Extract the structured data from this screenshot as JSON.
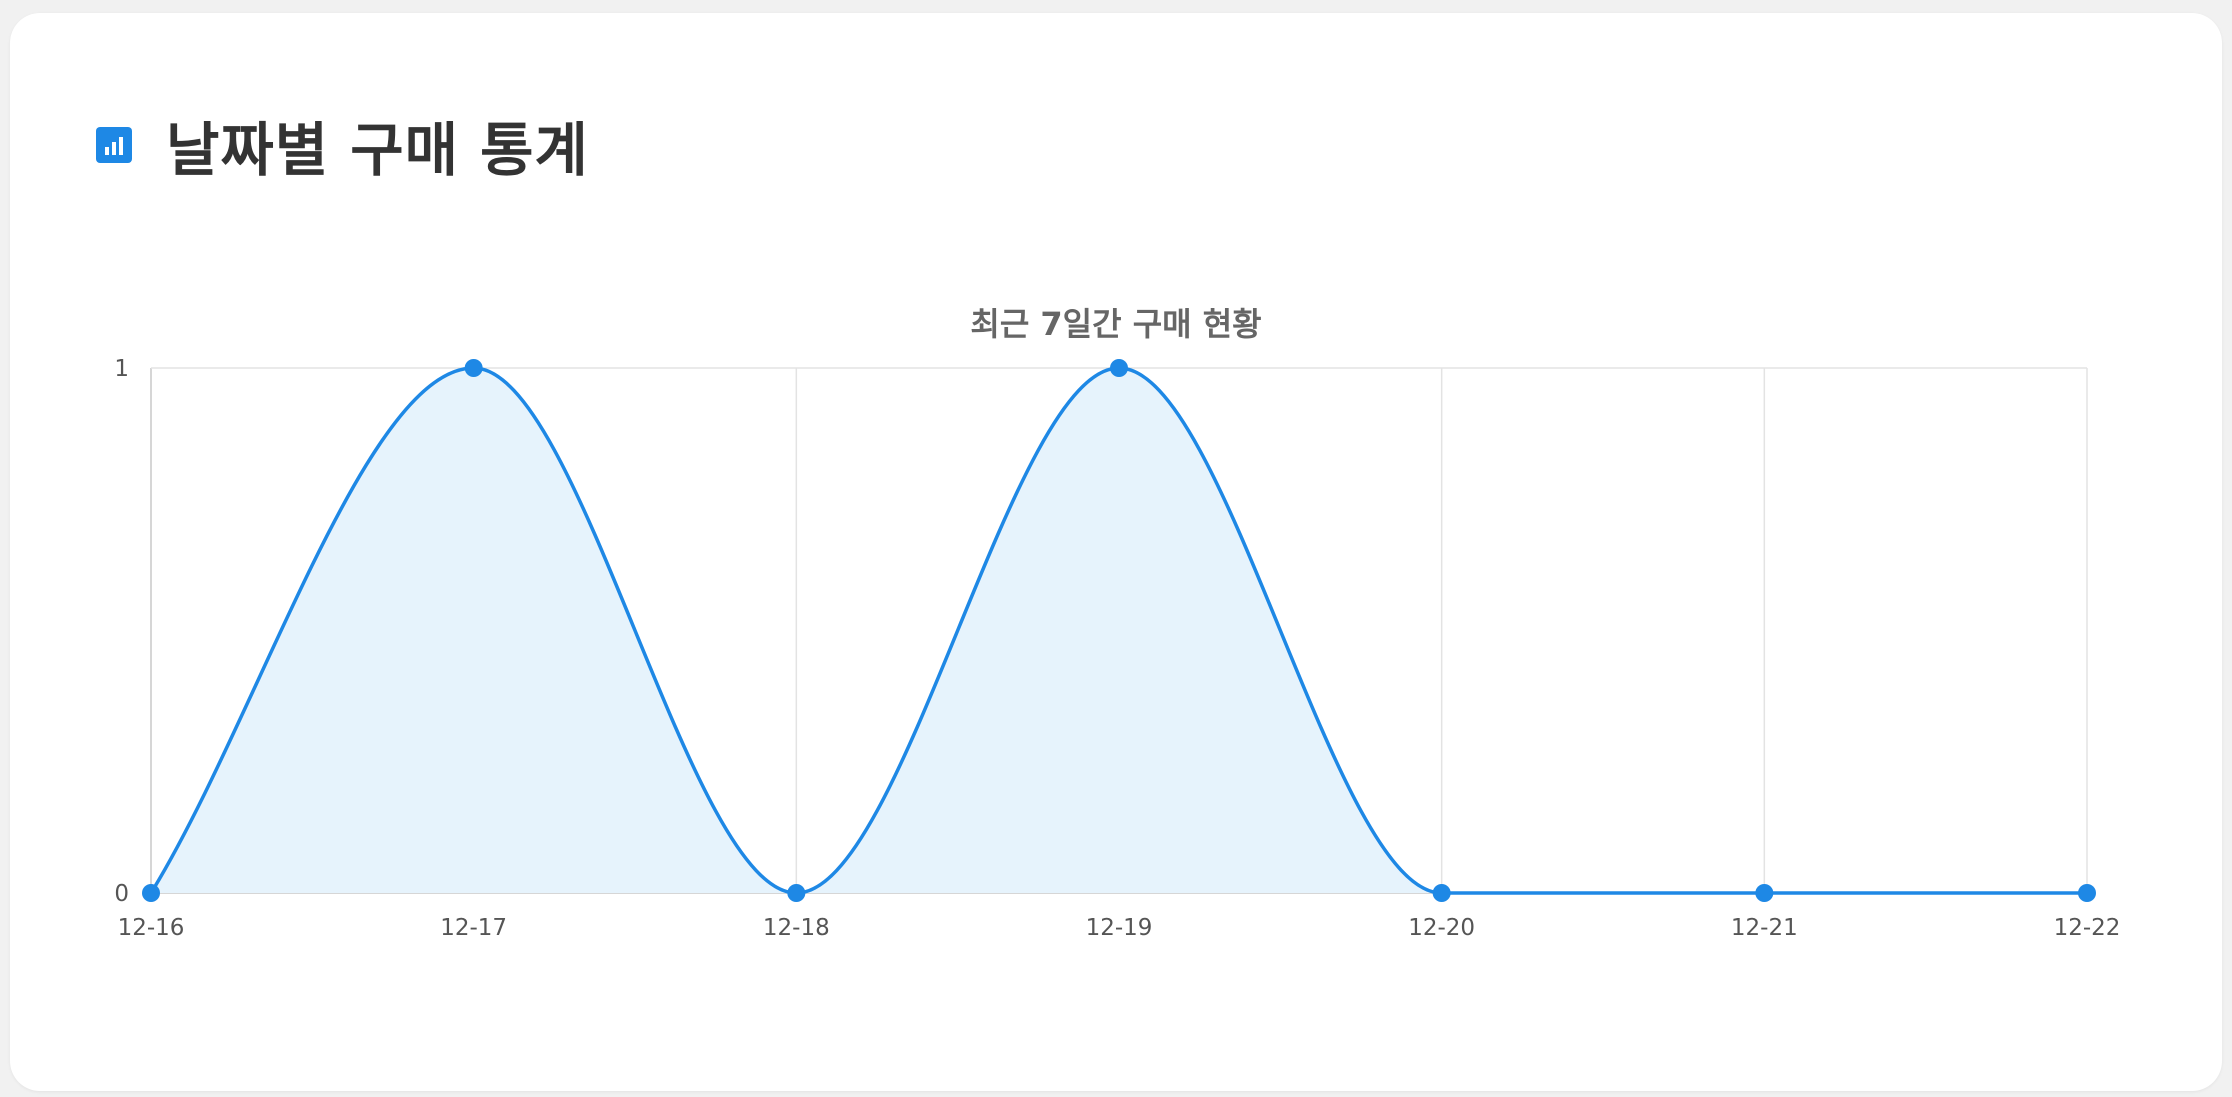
{
  "header": {
    "icon": "bar-chart-icon",
    "title": "날짜별 구매 통계"
  },
  "colors": {
    "accent": "#1e88e5",
    "fill": "#e6f3fc",
    "grid": "#e3e3e3",
    "text": "#555555",
    "title_text": "#666666"
  },
  "chart_data": {
    "type": "line",
    "title": "최근 7일간 구매 현황",
    "categories": [
      "12-16",
      "12-17",
      "12-18",
      "12-19",
      "12-20",
      "12-21",
      "12-22"
    ],
    "series": [
      {
        "values": [
          0,
          1,
          0,
          1,
          0,
          0,
          0
        ]
      }
    ],
    "ylim": [
      0,
      1
    ],
    "yticks": [
      0,
      1
    ],
    "filled": true,
    "smooth": true,
    "grid": true,
    "legend": "none"
  }
}
